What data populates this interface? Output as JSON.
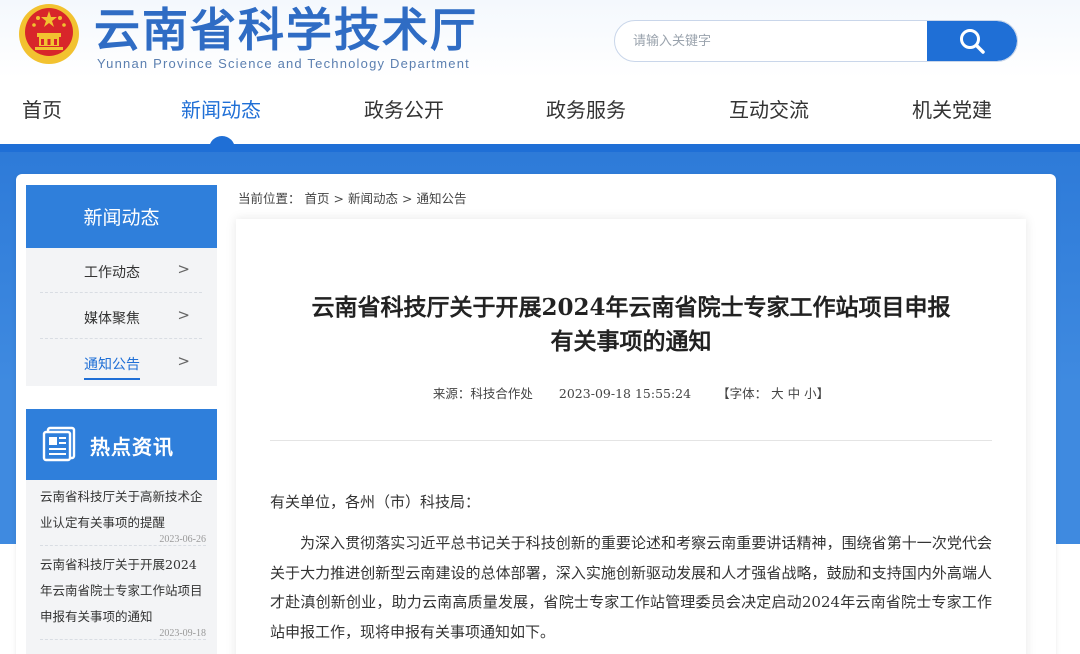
{
  "header": {
    "title": "云南省科学技术厅",
    "subtitle": "Yunnan Province Science and Technology Department",
    "search_placeholder": "请输入关键字"
  },
  "nav": {
    "items": [
      {
        "label": "首页"
      },
      {
        "label": "新闻动态",
        "active": true
      },
      {
        "label": "政务公开"
      },
      {
        "label": "政务服务"
      },
      {
        "label": "互动交流"
      },
      {
        "label": "机关党建"
      }
    ]
  },
  "sidebar": {
    "heading": "新闻动态",
    "items": [
      {
        "label": "工作动态",
        "arrow": ">"
      },
      {
        "label": "媒体聚焦",
        "arrow": ">"
      },
      {
        "label": "通知公告",
        "arrow": ">",
        "active": true
      }
    ]
  },
  "hot": {
    "heading": "热点资讯",
    "items": [
      {
        "title": "云南省科技厅关于高新技术企业认定有关事项的提醒",
        "date": "2023-06-26"
      },
      {
        "title": "云南省科技厅关于开展2024年云南省院士专家工作站项目申报有关事项的通知",
        "date": "2023-09-18"
      }
    ]
  },
  "breadcrumb": {
    "prefix": "当前位置：",
    "home": "首页",
    "sep": ">",
    "section": "新闻动态",
    "current": "通知公告"
  },
  "article": {
    "title_line1": "云南省科技厅关于开展2024年云南省院士专家工作站项目申报",
    "title_line2": "有关事项的通知",
    "source_label": "来源：",
    "source": "科技合作处",
    "datetime": "2023-09-18 15:55:24",
    "font_label": "【字体：",
    "font_large": "大",
    "font_medium": "中",
    "font_small": "小",
    "font_end": "】",
    "salutation": "有关单位，各州（市）科技局：",
    "paragraph": "为深入贯彻落实习近平总书记关于科技创新的重要论述和考察云南重要讲话精神，围绕省第十一次党代会关于大力推进创新型云南建设的总体部署，深入实施创新驱动发展和人才强省战略，鼓励和支持国内外高端人才赴滇创新创业，助力云南高质量发展，省院士专家工作站管理委员会决定启动2024年云南省院士专家工作站申报工作，现将申报有关事项通知如下。"
  },
  "colors": {
    "primary": "#1f6fd6",
    "title_blue": "#2f6cc4",
    "sidebar_blue": "#2f7fdb",
    "emblem_red": "#d8262a",
    "emblem_gold": "#f2c230"
  }
}
